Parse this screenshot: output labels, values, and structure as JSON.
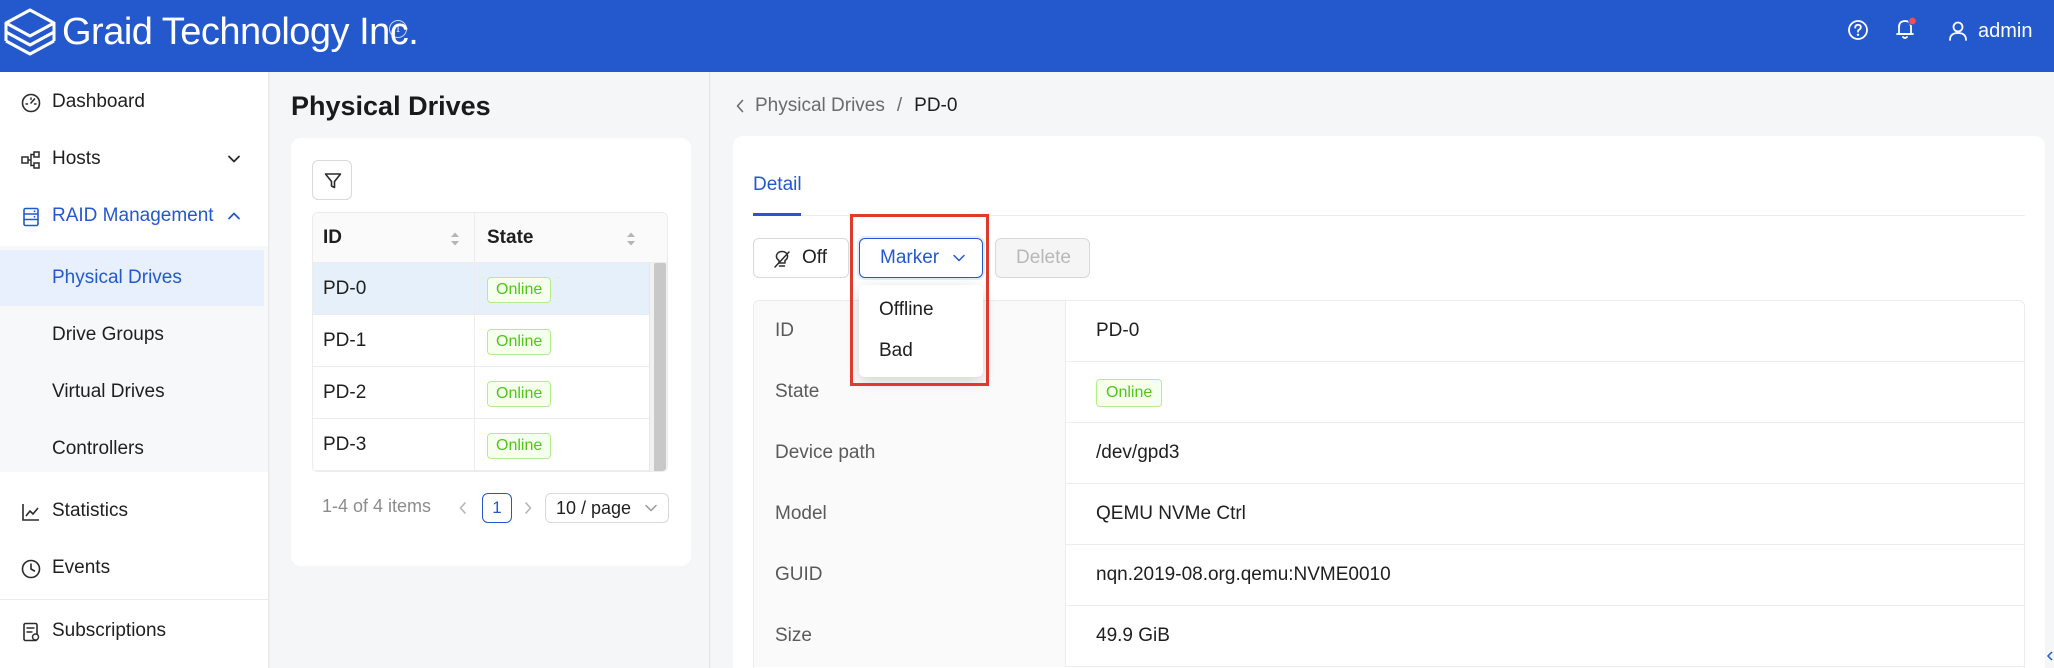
{
  "header": {
    "brand": "Graid Technology Inc.",
    "info_glyph": "i",
    "help_icon": "question-circle-icon",
    "bell_icon": "bell-icon",
    "has_notification": true,
    "user_icon": "user-icon",
    "username": "admin",
    "color": "#2458cd"
  },
  "sidebar": {
    "items": [
      {
        "label": "Dashboard",
        "icon": "dashboard-icon"
      },
      {
        "label": "Hosts",
        "icon": "hosts-icon"
      },
      {
        "label": "RAID Management",
        "icon": "raid-icon"
      },
      {
        "label": "Physical Drives"
      },
      {
        "label": "Drive Groups"
      },
      {
        "label": "Virtual Drives"
      },
      {
        "label": "Controllers"
      },
      {
        "label": "Statistics",
        "icon": "chart-line-icon"
      },
      {
        "label": "Events",
        "icon": "clock-icon"
      },
      {
        "label": "Subscriptions",
        "icon": "subscriptions-icon"
      }
    ],
    "selected": "Physical Drives"
  },
  "list": {
    "title": "Physical Drives",
    "columns": [
      "ID",
      "State"
    ],
    "rows": [
      {
        "id": "PD-0",
        "state": "Online"
      },
      {
        "id": "PD-1",
        "state": "Online"
      },
      {
        "id": "PD-2",
        "state": "Online"
      },
      {
        "id": "PD-3",
        "state": "Online"
      }
    ],
    "pagination": {
      "total_text": "1-4 of 4 items",
      "current_page": "1",
      "page_size": "10 / page"
    }
  },
  "detail": {
    "breadcrumb": [
      "Physical Drives",
      "/",
      "PD-0"
    ],
    "tab": "Detail",
    "buttons": {
      "off": "Off",
      "marker": "Marker",
      "delete": "Delete"
    },
    "marker_menu": [
      "Offline",
      "Bad"
    ],
    "fields": [
      {
        "label": "ID",
        "value": "PD-0"
      },
      {
        "label": "State",
        "value": "Online"
      },
      {
        "label": "Device path",
        "value": "/dev/gpd3"
      },
      {
        "label": "Model",
        "value": "QEMU NVMe Ctrl"
      },
      {
        "label": "GUID",
        "value": "nqn.2019-08.org.qemu:NVME0010"
      },
      {
        "label": "Size",
        "value": "49.9 GiB"
      }
    ]
  },
  "colors": {
    "accent": "#2458cd",
    "online_text": "#52c41a",
    "highlight_box": "#e03a2e"
  }
}
